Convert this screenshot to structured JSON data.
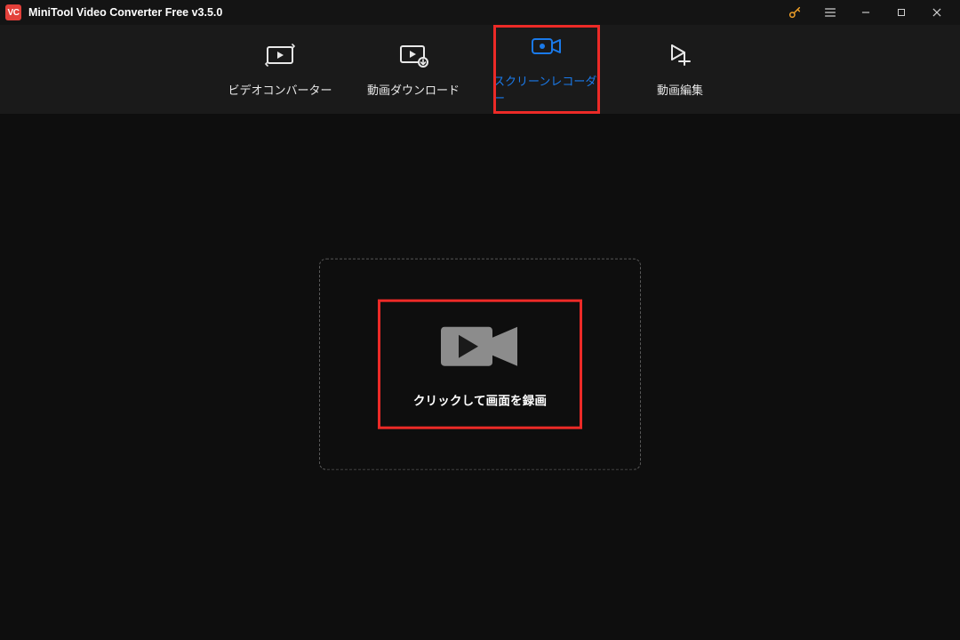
{
  "app": {
    "title": "MiniTool Video Converter Free v3.5.0",
    "logo_label": "VC"
  },
  "tabs": {
    "converter": "ビデオコンバーター",
    "download": "動画ダウンロード",
    "recorder": "スクリーンレコーダー",
    "editor": "動画編集"
  },
  "main": {
    "record_label": "クリックして画面を録画"
  }
}
